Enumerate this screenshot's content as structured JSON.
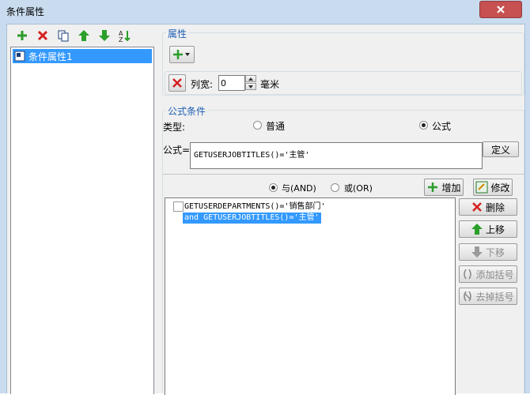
{
  "window": {
    "title": "条件属性"
  },
  "toolbar": {
    "icons": [
      "add-icon",
      "delete-icon",
      "copy-icon",
      "move-up-icon",
      "move-down-icon",
      "sort-icon"
    ]
  },
  "tree": {
    "items": [
      {
        "label": "条件属性1",
        "selected": true
      }
    ]
  },
  "properties": {
    "legend": "属性",
    "column_width_label": "列宽:",
    "column_width_value": "0",
    "unit_label": "毫米"
  },
  "formula_condition": {
    "legend": "公式条件",
    "type_label": "类型:",
    "type_options": [
      {
        "label": "普通",
        "selected": false
      },
      {
        "label": "公式",
        "selected": true
      }
    ],
    "formula_label": "公式=",
    "formula_value": "GETUSERJOBTITLES()='主管'",
    "define_button": "定义",
    "logic_options": [
      {
        "label": "与(AND)",
        "selected": true
      },
      {
        "label": "或(OR)",
        "selected": false
      }
    ],
    "add_button": "增加",
    "modify_button": "修改",
    "conditions": [
      {
        "text": "GETUSERDEPARTMENTS()='销售部门'",
        "selected": false
      },
      {
        "text": "and GETUSERJOBTITLES()='主管'",
        "selected": true
      }
    ],
    "side_buttons": {
      "delete": "删除",
      "move_up": "上移",
      "move_down": "下移",
      "add_bracket": "添加括号",
      "remove_bracket": "去掉括号"
    }
  }
}
